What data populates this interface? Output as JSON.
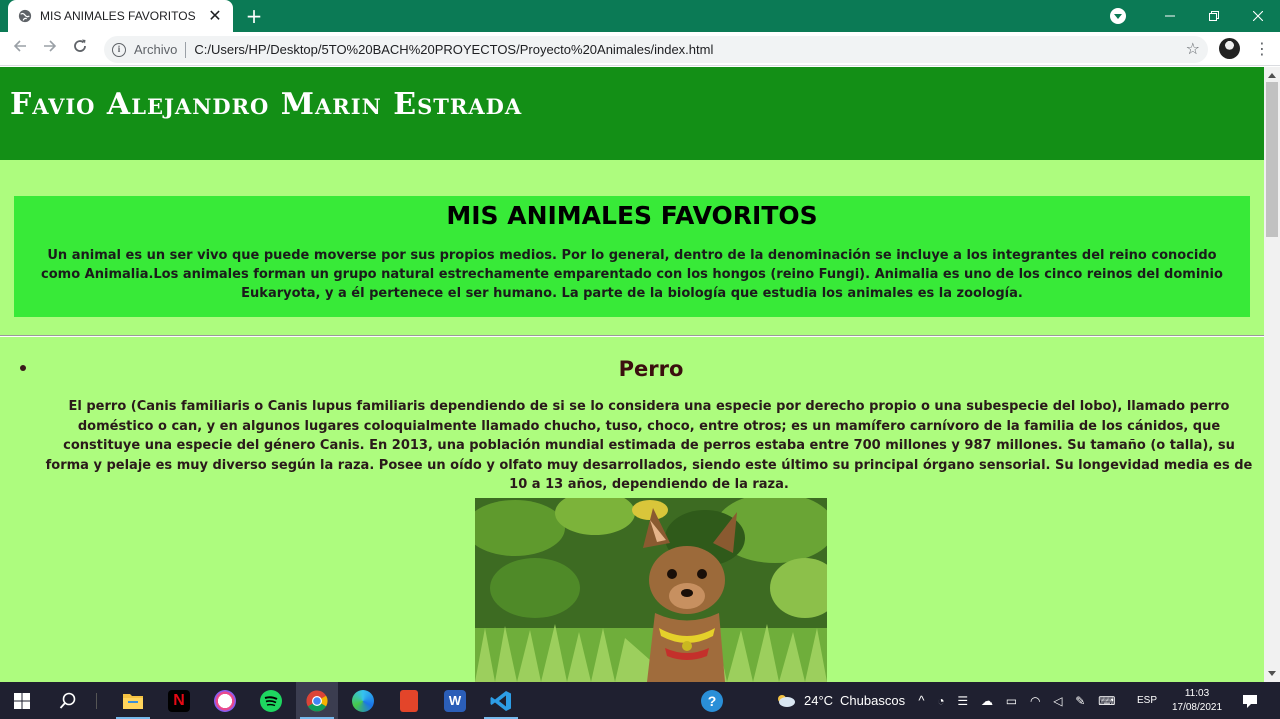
{
  "browser": {
    "tab_title": "MIS ANIMALES FAVORITOS",
    "tab_close": "✕",
    "new_tab": "+",
    "scheme_label": "Archivo",
    "url": "C:/Users/HP/Desktop/5TO%20BACH%20PROYECTOS/Proyecto%20Animales/index.html",
    "theme_color": "#0b7a55"
  },
  "page": {
    "header_title": "Favio Alejandro Marin Estrada",
    "intro_heading": "MIS ANIMALES FAVORITOS",
    "intro_text": "Un animal es un ser vivo que puede moverse por sus propios medios. Por lo general, dentro de la denominación se incluye a los integrantes del reino conocido como Animalia.Los animales forman un grupo natural estrechamente emparentado con los hongos (reino Fungi). Animalia es uno de los cinco reinos del dominio Eukaryota, y a él pertenece el ser humano. La parte de la biología que estudia los animales es la zoología.",
    "animals": [
      {
        "name": "Perro",
        "description": "El perro (Canis familiaris o Canis lupus familiaris dependiendo de si se lo considera una especie por derecho propio o una subespecie del lobo), llamado perro doméstico o can, y en algunos lugares coloquialmente llamado chucho, tuso, choco, entre otros; es un mamífero carnívoro de la familia de los cánidos, que constituye una especie del género Canis. En 2013, una población mundial estimada de perros estaba entre 700 millones y 987 millones. Su tamaño (o talla), su forma y pelaje es muy diverso según la raza. Posee un oído y olfato muy desarrollados, siendo este último su principal órgano sensorial. Su longevidad media es de 10 a 13 años, dependiendo de la raza."
      }
    ],
    "colors": {
      "header_bg": "#138f16",
      "page_bg": "#adfc7e",
      "intro_bg": "#38ea38"
    }
  },
  "taskbar": {
    "weather_temp": "24°C",
    "weather_desc": "Chubascos",
    "language": "ESP",
    "time": "11:03",
    "date": "17/08/2021",
    "apps": [
      "windows-start",
      "search",
      "file-explorer",
      "netflix",
      "itunes",
      "spotify",
      "chrome",
      "edge",
      "office",
      "word",
      "vscode"
    ]
  }
}
